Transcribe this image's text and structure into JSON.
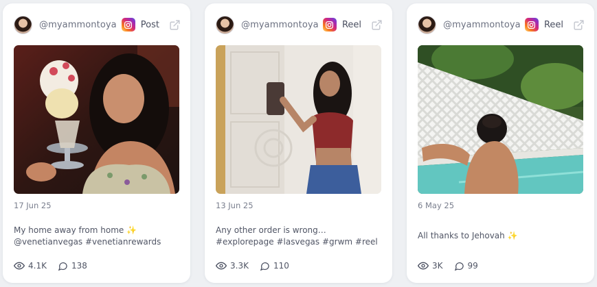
{
  "cards": [
    {
      "handle": "@myammontoya",
      "post_type": "Post",
      "date": "17 Jun 25",
      "caption": "My home away from home ✨ @venetianvegas #venetianrewards",
      "views": "4.1K",
      "comments": "138"
    },
    {
      "handle": "@myammontoya",
      "post_type": "Reel",
      "date": "13 Jun 25",
      "caption": "Any other order is wrong… #explorepage #lasvegas #grwm #reel",
      "views": "3.3K",
      "comments": "110"
    },
    {
      "handle": "@myammontoya",
      "post_type": "Reel",
      "date": "6 May 25",
      "caption": "All thanks to Jehovah ✨",
      "views": "3K",
      "comments": "99"
    }
  ],
  "colors": {
    "background": "#eef0f3",
    "card": "#ffffff",
    "sparkle": "#f2b432",
    "instagram_gradient": [
      "#feda75",
      "#fa7e1e",
      "#d62976",
      "#962fbf",
      "#4f5bd5"
    ]
  },
  "icons": {
    "platform": "instagram-icon",
    "open": "external-link-icon",
    "views": "eye-icon",
    "comments": "comment-icon"
  }
}
